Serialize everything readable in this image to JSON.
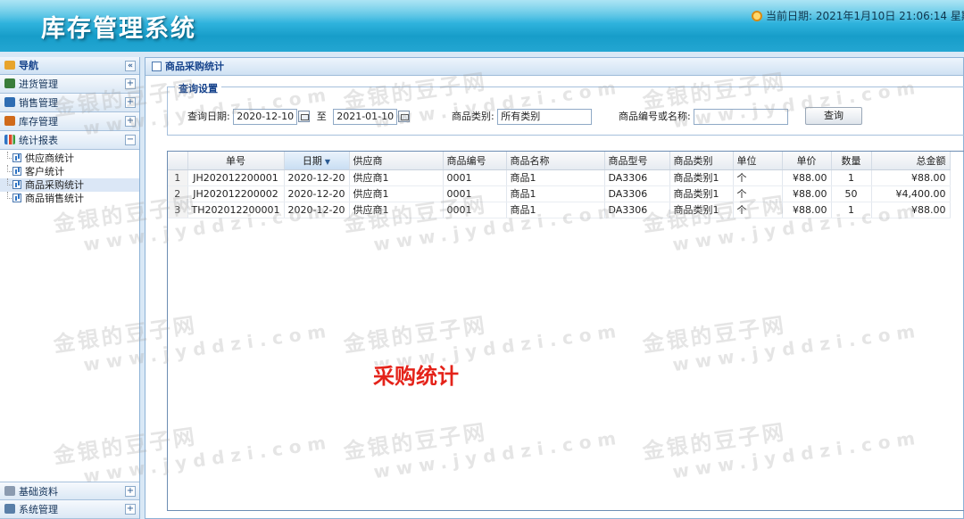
{
  "header": {
    "title": "库存管理系统",
    "date_label": "当前日期:",
    "date_value": "2021年1月10日 21:06:14 星期"
  },
  "sidebar": {
    "title": "导航",
    "groups_top": [
      {
        "label": "进货管理",
        "icon": "purchase-icon",
        "color": "#3a7d3a"
      },
      {
        "label": "销售管理",
        "icon": "sales-icon",
        "color": "#2f6db3"
      },
      {
        "label": "库存管理",
        "icon": "inventory-icon",
        "color": "#d06a1a"
      }
    ],
    "stats_group": {
      "label": "统计报表",
      "icon": "chart-icon"
    },
    "stats_items": [
      {
        "label": "供应商统计",
        "active": false
      },
      {
        "label": "客户统计",
        "active": false
      },
      {
        "label": "商品采购统计",
        "active": true
      },
      {
        "label": "商品销售统计",
        "active": false
      }
    ],
    "groups_bottom": [
      {
        "label": "基础资料",
        "icon": "basic-data-icon"
      },
      {
        "label": "系统管理",
        "icon": "system-icon"
      }
    ]
  },
  "main": {
    "tab_title": "商品采购统计",
    "query": {
      "legend": "查询设置",
      "date_label": "查询日期:",
      "date_from": "2020-12-10",
      "to_label": "至",
      "date_to": "2021-01-10",
      "category_label": "商品类别:",
      "category_value": "所有类别",
      "code_label": "商品编号或名称:",
      "code_value": "",
      "search_button": "查询"
    },
    "table": {
      "columns": [
        "单号",
        "日期",
        "供应商",
        "商品编号",
        "商品名称",
        "商品型号",
        "商品类别",
        "单位",
        "单价",
        "数量",
        "总金额"
      ],
      "sort_indicator": "▼",
      "rows": [
        {
          "no": "1",
          "order": "JH202012200001",
          "date": "2020-12-20",
          "supplier": "供应商1",
          "code": "0001",
          "name": "商品1",
          "model": "DA3306",
          "category": "商品类别1",
          "unit": "个",
          "price": "¥88.00",
          "qty": "1",
          "total": "¥88.00"
        },
        {
          "no": "2",
          "order": "JH202012200002",
          "date": "2020-12-20",
          "supplier": "供应商1",
          "code": "0001",
          "name": "商品1",
          "model": "DA3306",
          "category": "商品类别1",
          "unit": "个",
          "price": "¥88.00",
          "qty": "50",
          "total": "¥4,400.00"
        },
        {
          "no": "3",
          "order": "TH202012200001",
          "date": "2020-12-20",
          "supplier": "供应商1",
          "code": "0001",
          "name": "商品1",
          "model": "DA3306",
          "category": "商品类别1",
          "unit": "个",
          "price": "¥88.00",
          "qty": "1",
          "total": "¥88.00"
        }
      ]
    }
  },
  "overlay": {
    "caption": "采购统计",
    "watermark_cn": "金银的豆子网",
    "watermark_url": "www.jyddzi.com"
  }
}
